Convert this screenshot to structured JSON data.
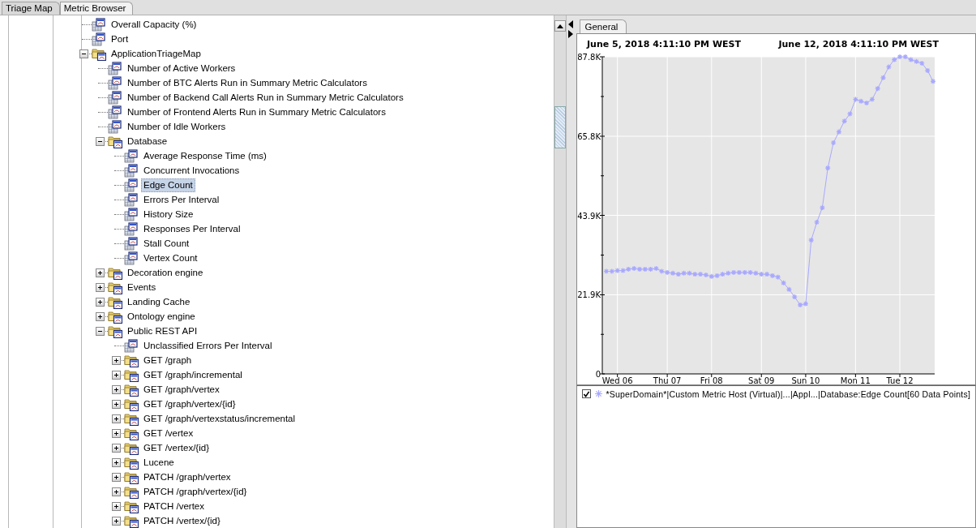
{
  "tabs": [
    {
      "label": "Triage Map",
      "selected": false
    },
    {
      "label": "Metric Browser",
      "selected": true
    }
  ],
  "tree": [
    {
      "kind": "metric",
      "label": "Overall Capacity (%)",
      "selected": false
    },
    {
      "kind": "metric",
      "label": "Port",
      "selected": false
    },
    {
      "kind": "folder",
      "label": "ApplicationTriageMap",
      "expanded": true,
      "selected": false,
      "children": [
        {
          "kind": "metric",
          "label": "Number of Active Workers",
          "selected": false
        },
        {
          "kind": "metric",
          "label": "Number of BTC Alerts Run in Summary Metric Calculators",
          "selected": false
        },
        {
          "kind": "metric",
          "label": "Number of Backend Call Alerts Run in Summary Metric Calculators",
          "selected": false
        },
        {
          "kind": "metric",
          "label": "Number of Frontend Alerts Run in Summary Metric Calculators",
          "selected": false
        },
        {
          "kind": "metric",
          "label": "Number of Idle Workers",
          "selected": false
        },
        {
          "kind": "folder",
          "label": "Database",
          "expanded": true,
          "selected": false,
          "children": [
            {
              "kind": "metric",
              "label": "Average Response Time (ms)",
              "selected": false
            },
            {
              "kind": "metric",
              "label": "Concurrent Invocations",
              "selected": false
            },
            {
              "kind": "metric",
              "label": "Edge Count",
              "selected": true
            },
            {
              "kind": "metric",
              "label": "Errors Per Interval",
              "selected": false
            },
            {
              "kind": "metric",
              "label": "History Size",
              "selected": false
            },
            {
              "kind": "metric",
              "label": "Responses Per Interval",
              "selected": false
            },
            {
              "kind": "metric",
              "label": "Stall Count",
              "selected": false
            },
            {
              "kind": "metric",
              "label": "Vertex Count",
              "selected": false
            }
          ]
        },
        {
          "kind": "folder",
          "label": "Decoration engine",
          "expanded": false,
          "selected": false
        },
        {
          "kind": "folder",
          "label": "Events",
          "expanded": false,
          "selected": false
        },
        {
          "kind": "folder",
          "label": "Landing Cache",
          "expanded": false,
          "selected": false
        },
        {
          "kind": "folder",
          "label": "Ontology engine",
          "expanded": false,
          "selected": false
        },
        {
          "kind": "folder",
          "label": "Public REST API",
          "expanded": true,
          "selected": false,
          "children": [
            {
              "kind": "metric",
              "label": "Unclassified Errors Per Interval",
              "selected": false
            },
            {
              "kind": "folder",
              "label": "GET /graph",
              "expanded": false,
              "selected": false
            },
            {
              "kind": "folder",
              "label": "GET /graph/incremental",
              "expanded": false,
              "selected": false
            },
            {
              "kind": "folder",
              "label": "GET /graph/vertex",
              "expanded": false,
              "selected": false
            },
            {
              "kind": "folder",
              "label": "GET /graph/vertex/{id}",
              "expanded": false,
              "selected": false
            },
            {
              "kind": "folder",
              "label": "GET /graph/vertexstatus/incremental",
              "expanded": false,
              "selected": false
            },
            {
              "kind": "folder",
              "label": "GET /vertex",
              "expanded": false,
              "selected": false
            },
            {
              "kind": "folder",
              "label": "GET /vertex/{id}",
              "expanded": false,
              "selected": false
            },
            {
              "kind": "folder",
              "label": "Lucene",
              "expanded": false,
              "selected": false
            },
            {
              "kind": "folder",
              "label": "PATCH /graph/vertex",
              "expanded": false,
              "selected": false
            },
            {
              "kind": "folder",
              "label": "PATCH /graph/vertex/{id}",
              "expanded": false,
              "selected": false
            },
            {
              "kind": "folder",
              "label": "PATCH /vertex",
              "expanded": false,
              "selected": false
            },
            {
              "kind": "folder",
              "label": "PATCH /vertex/{id}",
              "expanded": false,
              "selected": false
            }
          ]
        }
      ]
    }
  ],
  "detail_tabs": [
    {
      "label": "General",
      "selected": true
    }
  ],
  "chart": {
    "range_start": "June 5, 2018 4:11:10 PM WEST",
    "range_end": "June 12, 2018 4:11:10 PM WEST",
    "chart_data": {
      "type": "line",
      "grid": true,
      "ylim": [
        0,
        87.8
      ],
      "categories": [
        null,
        null,
        "Wed 06",
        null,
        null,
        null,
        null,
        null,
        null,
        null,
        null,
        "Thu 07",
        null,
        null,
        null,
        null,
        null,
        null,
        null,
        "Fri 08",
        null,
        null,
        null,
        null,
        null,
        null,
        null,
        null,
        "Sat 09",
        null,
        null,
        null,
        null,
        null,
        null,
        null,
        "Sun 10",
        null,
        null,
        null,
        null,
        null,
        null,
        null,
        null,
        "Mon 11",
        null,
        null,
        null,
        null,
        null,
        null,
        null,
        "Tue 12",
        null,
        null,
        null,
        null,
        null,
        null
      ],
      "yticks": [
        {
          "value": 0,
          "label": "0"
        },
        {
          "value": 21.9,
          "label": "21.9K"
        },
        {
          "value": 43.9,
          "label": "43.9K"
        },
        {
          "value": 65.8,
          "label": "65.8K"
        },
        {
          "value": 87.8,
          "label": "87.8K"
        }
      ],
      "series": [
        {
          "name": "*SuperDomain*|Custom Metric Host (Virtual)|...|Appl...|Database:Edge Count",
          "color": "#a8a8ff",
          "values": [
            28.4,
            28.4,
            28.6,
            28.6,
            29.0,
            29.2,
            29.0,
            29.0,
            29.0,
            29.2,
            28.4,
            28.1,
            27.9,
            27.6,
            27.9,
            27.9,
            27.6,
            27.6,
            27.4,
            27.0,
            27.2,
            27.6,
            27.9,
            28.1,
            28.1,
            28.1,
            28.1,
            27.9,
            27.6,
            27.6,
            27.2,
            26.8,
            25.2,
            23.4,
            21.3,
            19.1,
            19.4,
            37,
            42,
            46,
            57,
            64,
            67,
            70,
            72,
            76,
            75.5,
            75,
            76,
            79,
            82,
            85,
            87,
            87.8,
            87.8,
            87,
            86.5,
            86,
            84,
            81
          ]
        }
      ]
    }
  },
  "legend": [
    {
      "checked": true,
      "points": "[60 Data Points]"
    }
  ]
}
